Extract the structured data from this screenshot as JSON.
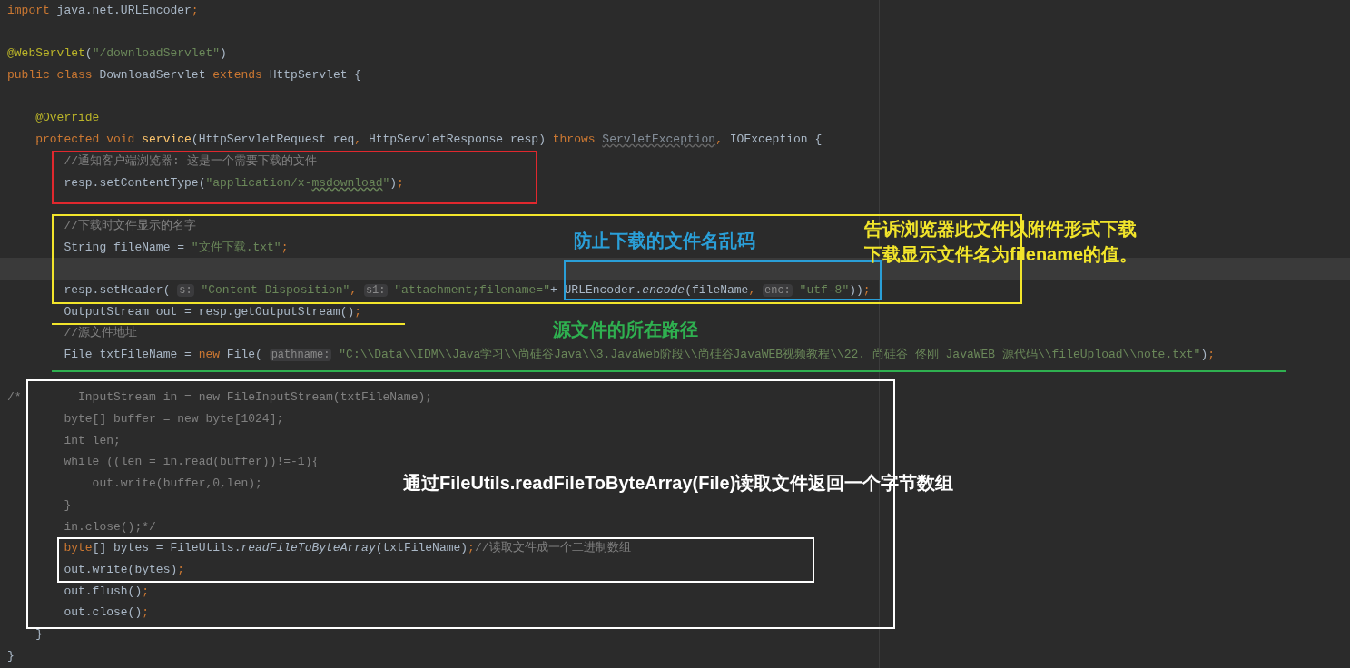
{
  "code_lines": [
    {
      "current": false,
      "tokens": [
        {
          "kind": "kw",
          "t": "import"
        },
        {
          "kind": "plain",
          "t": " java.net.URLEncoder"
        },
        {
          "kind": "kw",
          "t": ";"
        }
      ]
    },
    {
      "current": false
    },
    {
      "current": false,
      "tokens": [
        {
          "kind": "ann",
          "t": "@WebServlet"
        },
        {
          "kind": "plain",
          "t": "("
        },
        {
          "kind": "str",
          "t": "\"/downloadServlet\""
        },
        {
          "kind": "plain",
          "t": ")"
        }
      ]
    },
    {
      "current": false,
      "tokens": [
        {
          "kind": "kw",
          "t": "public class "
        },
        {
          "kind": "plain",
          "t": "DownloadServlet "
        },
        {
          "kind": "kw",
          "t": "extends "
        },
        {
          "kind": "plain",
          "t": "HttpServlet {"
        }
      ]
    },
    {
      "current": false
    },
    {
      "current": false,
      "tokens": [
        {
          "kind": "ann",
          "t": "    @Override"
        }
      ]
    },
    {
      "current": false,
      "tokens": [
        {
          "kind": "kw",
          "t": "    protected void "
        },
        {
          "kind": "fn",
          "t": "service"
        },
        {
          "kind": "plain",
          "t": "(HttpServletRequest req"
        },
        {
          "kind": "kw",
          "t": ","
        },
        {
          "kind": "plain",
          "t": " HttpServletResponse resp) "
        },
        {
          "kind": "kw",
          "t": "throws "
        },
        {
          "kind": "warn",
          "t": "ServletException"
        },
        {
          "kind": "kw",
          "t": ","
        },
        {
          "kind": "plain",
          "t": " IOException {"
        }
      ]
    },
    {
      "current": false,
      "tokens": [
        {
          "kind": "cmt",
          "t": "        //通知客户端浏览器: 这是一个需要下载的文件"
        }
      ]
    },
    {
      "current": false,
      "tokens": [
        {
          "kind": "plain",
          "t": "        resp.setContentType("
        },
        {
          "kind": "str",
          "t": "\"application/x-"
        },
        {
          "kind": "strwarn",
          "t": "msdownload"
        },
        {
          "kind": "str",
          "t": "\""
        },
        {
          "kind": "plain",
          "t": ")"
        },
        {
          "kind": "kw",
          "t": ";"
        }
      ]
    },
    {
      "current": false
    },
    {
      "current": false,
      "tokens": [
        {
          "kind": "cmt",
          "t": "        //下载时文件显示的名字"
        }
      ]
    },
    {
      "current": false,
      "tokens": [
        {
          "kind": "plain",
          "t": "        String fileName = "
        },
        {
          "kind": "str",
          "t": "\"文件下载.txt\""
        },
        {
          "kind": "kw",
          "t": ";"
        }
      ]
    },
    {
      "current": true
    },
    {
      "current": false,
      "tokens": [
        {
          "kind": "plain",
          "t": "        resp.setHeader( "
        },
        {
          "kind": "hint",
          "t": "s:"
        },
        {
          "kind": "str",
          "t": " \"Content-Disposition\""
        },
        {
          "kind": "kw",
          "t": ", "
        },
        {
          "kind": "hint",
          "t": "s1:"
        },
        {
          "kind": "str",
          "t": " \"attachment;filename=\""
        },
        {
          "kind": "plain",
          "t": "+ URLEncoder."
        },
        {
          "kind": "ital",
          "t": "encode"
        },
        {
          "kind": "plain",
          "t": "(fileName"
        },
        {
          "kind": "kw",
          "t": ", "
        },
        {
          "kind": "hint",
          "t": "enc:"
        },
        {
          "kind": "str",
          "t": " \"utf-8\""
        },
        {
          "kind": "plain",
          "t": "))"
        },
        {
          "kind": "kw",
          "t": ";"
        }
      ]
    },
    {
      "current": false,
      "tokens": [
        {
          "kind": "plain",
          "t": "        OutputStream out = resp.getOutputStream()"
        },
        {
          "kind": "kw",
          "t": ";"
        }
      ]
    },
    {
      "current": false,
      "tokens": [
        {
          "kind": "cmt",
          "t": "        //源文件地址"
        }
      ]
    },
    {
      "current": false,
      "tokens": [
        {
          "kind": "plain",
          "t": "        File txtFileName = "
        },
        {
          "kind": "kw",
          "t": "new "
        },
        {
          "kind": "plain",
          "t": "File( "
        },
        {
          "kind": "hint",
          "t": "pathname:"
        },
        {
          "kind": "str",
          "t": " \"C:\\\\Data\\\\IDM\\\\Java学习\\\\尚硅谷Java\\\\3.JavaWeb阶段\\\\尚硅谷JavaWEB视频教程\\\\22. 尚硅谷_佟刚_JavaWEB_源代码\\\\fileUpload\\\\note.txt\""
        },
        {
          "kind": "plain",
          "t": ")"
        },
        {
          "kind": "kw",
          "t": ";"
        }
      ]
    },
    {
      "current": false
    },
    {
      "current": false,
      "tokens": [
        {
          "kind": "cmt",
          "t": "/*        InputStream in = new FileInputStream(txtFileName);"
        }
      ]
    },
    {
      "current": false,
      "tokens": [
        {
          "kind": "cmt",
          "t": "        byte[] buffer = new byte[1024];"
        }
      ]
    },
    {
      "current": false,
      "tokens": [
        {
          "kind": "cmt",
          "t": "        int len;"
        }
      ]
    },
    {
      "current": false,
      "tokens": [
        {
          "kind": "cmt",
          "t": "        while ((len = in.read(buffer))!=-1){"
        }
      ]
    },
    {
      "current": false,
      "tokens": [
        {
          "kind": "cmt",
          "t": "            out.write(buffer,0,len);"
        }
      ]
    },
    {
      "current": false,
      "tokens": [
        {
          "kind": "cmt",
          "t": "        }"
        }
      ]
    },
    {
      "current": false,
      "tokens": [
        {
          "kind": "cmt",
          "t": "        in.close();*/"
        }
      ]
    },
    {
      "current": false,
      "tokens": [
        {
          "kind": "kw",
          "t": "        byte"
        },
        {
          "kind": "plain",
          "t": "[] bytes = FileUtils."
        },
        {
          "kind": "ital",
          "t": "readFileToByteArray"
        },
        {
          "kind": "plain",
          "t": "(txtFileName)"
        },
        {
          "kind": "kw",
          "t": ";"
        },
        {
          "kind": "cmt",
          "t": "//读取文件成一个二进制数组"
        }
      ]
    },
    {
      "current": false,
      "tokens": [
        {
          "kind": "plain",
          "t": "        out.write(bytes)"
        },
        {
          "kind": "kw",
          "t": ";"
        }
      ]
    },
    {
      "current": false,
      "tokens": [
        {
          "kind": "plain",
          "t": "        out.flush()"
        },
        {
          "kind": "kw",
          "t": ";"
        }
      ]
    },
    {
      "current": false,
      "tokens": [
        {
          "kind": "plain",
          "t": "        out.close()"
        },
        {
          "kind": "kw",
          "t": ";"
        }
      ]
    },
    {
      "current": false,
      "tokens": [
        {
          "kind": "plain",
          "t": "    }"
        }
      ]
    },
    {
      "current": false,
      "tokens": [
        {
          "kind": "plain",
          "t": "}"
        }
      ]
    }
  ],
  "annotation_marks": [
    {
      "kind": "box",
      "color": "#e0282e"
    },
    {
      "kind": "box",
      "color": "#f2e52b"
    },
    {
      "kind": "box",
      "color": "#2a9fd8"
    },
    {
      "kind": "underline",
      "color": "#f2e52b"
    },
    {
      "kind": "underline",
      "color": "#2fb050"
    },
    {
      "kind": "box",
      "color": "#ffffff"
    },
    {
      "kind": "box",
      "color": "#ffffff"
    }
  ],
  "annotation_notes": [
    {
      "text": "防止下载的文件名乱码",
      "color": "#2a9fd8"
    },
    {
      "text": "告诉浏览器此文件以附件形式下载",
      "color": "#f2e52b"
    },
    {
      "text": "下载显示文件名为filename的值。",
      "color": "#f2e52b"
    },
    {
      "text": "源文件的所在路径",
      "color": "#2fb050"
    },
    {
      "text": "通过FileUtils.readFileToByteArray(File)读取文件返回一个字节数组",
      "color": "#ffffff"
    }
  ]
}
